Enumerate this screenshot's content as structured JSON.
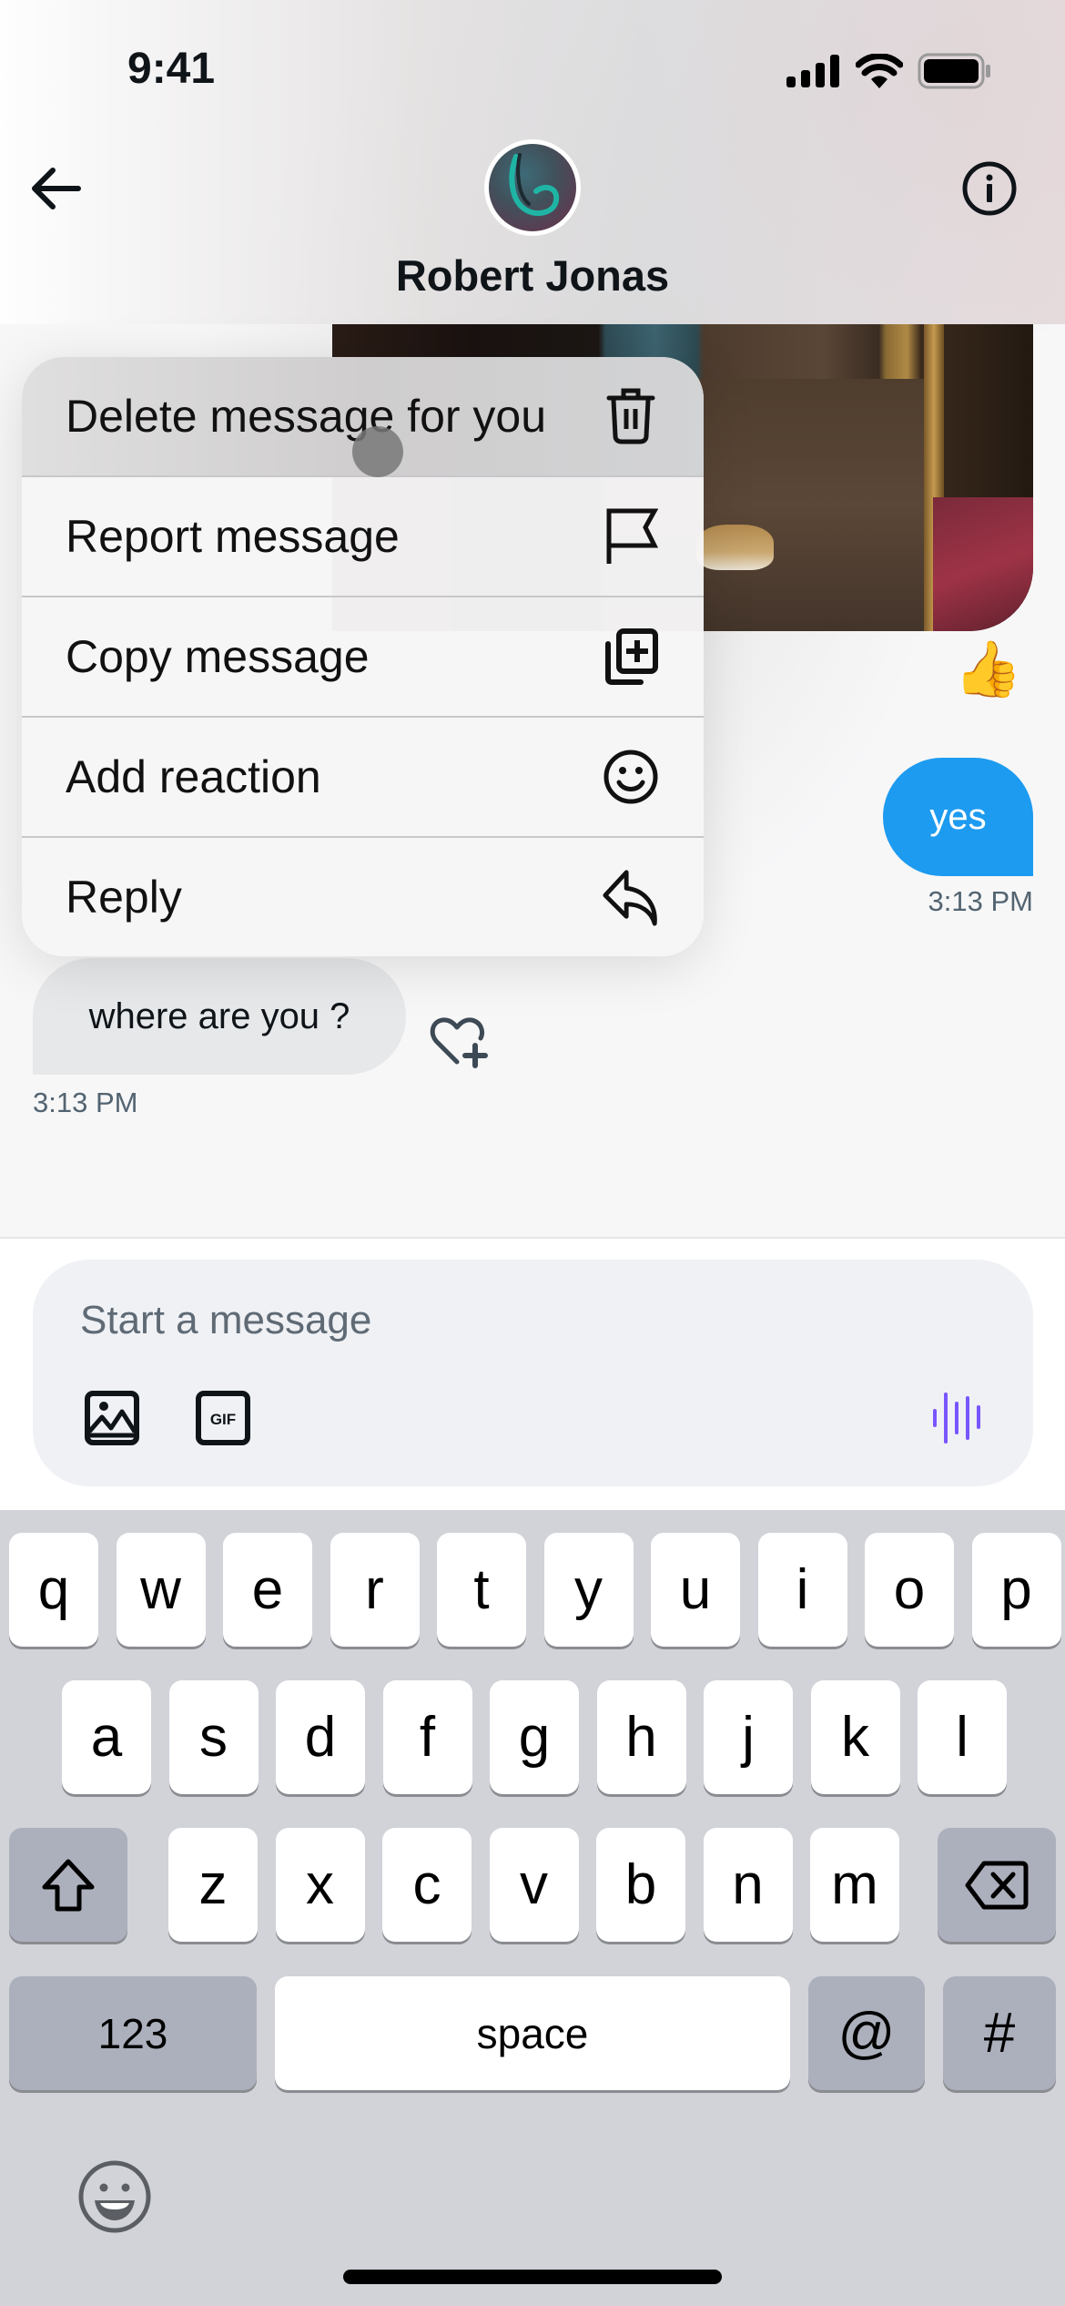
{
  "status_bar": {
    "time": "9:41",
    "icons": [
      "cellular-signal-icon",
      "wifi-icon",
      "battery-icon"
    ]
  },
  "header": {
    "contact_name": "Robert Jonas",
    "back_icon": "arrow-left-icon",
    "info_icon": "info-circle-icon"
  },
  "messages": {
    "image_reaction": "👍",
    "sent": {
      "text": "yes",
      "timestamp": "3:13 PM"
    },
    "received": {
      "text": "where are you ?",
      "timestamp": "3:13 PM",
      "react_icon": "heart-plus-icon"
    }
  },
  "context_menu": {
    "items": [
      {
        "label": "Delete message for you",
        "icon": "trash-icon"
      },
      {
        "label": "Report message",
        "icon": "flag-icon"
      },
      {
        "label": "Copy message",
        "icon": "copy-plus-icon"
      },
      {
        "label": "Add reaction",
        "icon": "smiley-icon"
      },
      {
        "label": "Reply",
        "icon": "reply-icon"
      }
    ]
  },
  "composer": {
    "placeholder": "Start a message",
    "value": "",
    "icons": [
      "image-icon",
      "gif-icon",
      "voice-waveform-icon"
    ],
    "gif_label": "GIF",
    "accent_color": "#7856ff"
  },
  "keyboard": {
    "row1": [
      "q",
      "w",
      "e",
      "r",
      "t",
      "y",
      "u",
      "i",
      "o",
      "p"
    ],
    "row2": [
      "a",
      "s",
      "d",
      "f",
      "g",
      "h",
      "j",
      "k",
      "l"
    ],
    "row3": [
      "z",
      "x",
      "c",
      "v",
      "b",
      "n",
      "m"
    ],
    "numbers_label": "123",
    "space_label": "space",
    "at_label": "@",
    "hash_label": "#"
  },
  "colors": {
    "sent_bubble": "#1d9bf0",
    "received_bubble": "#e6e8ea",
    "timestamp": "#536471"
  }
}
